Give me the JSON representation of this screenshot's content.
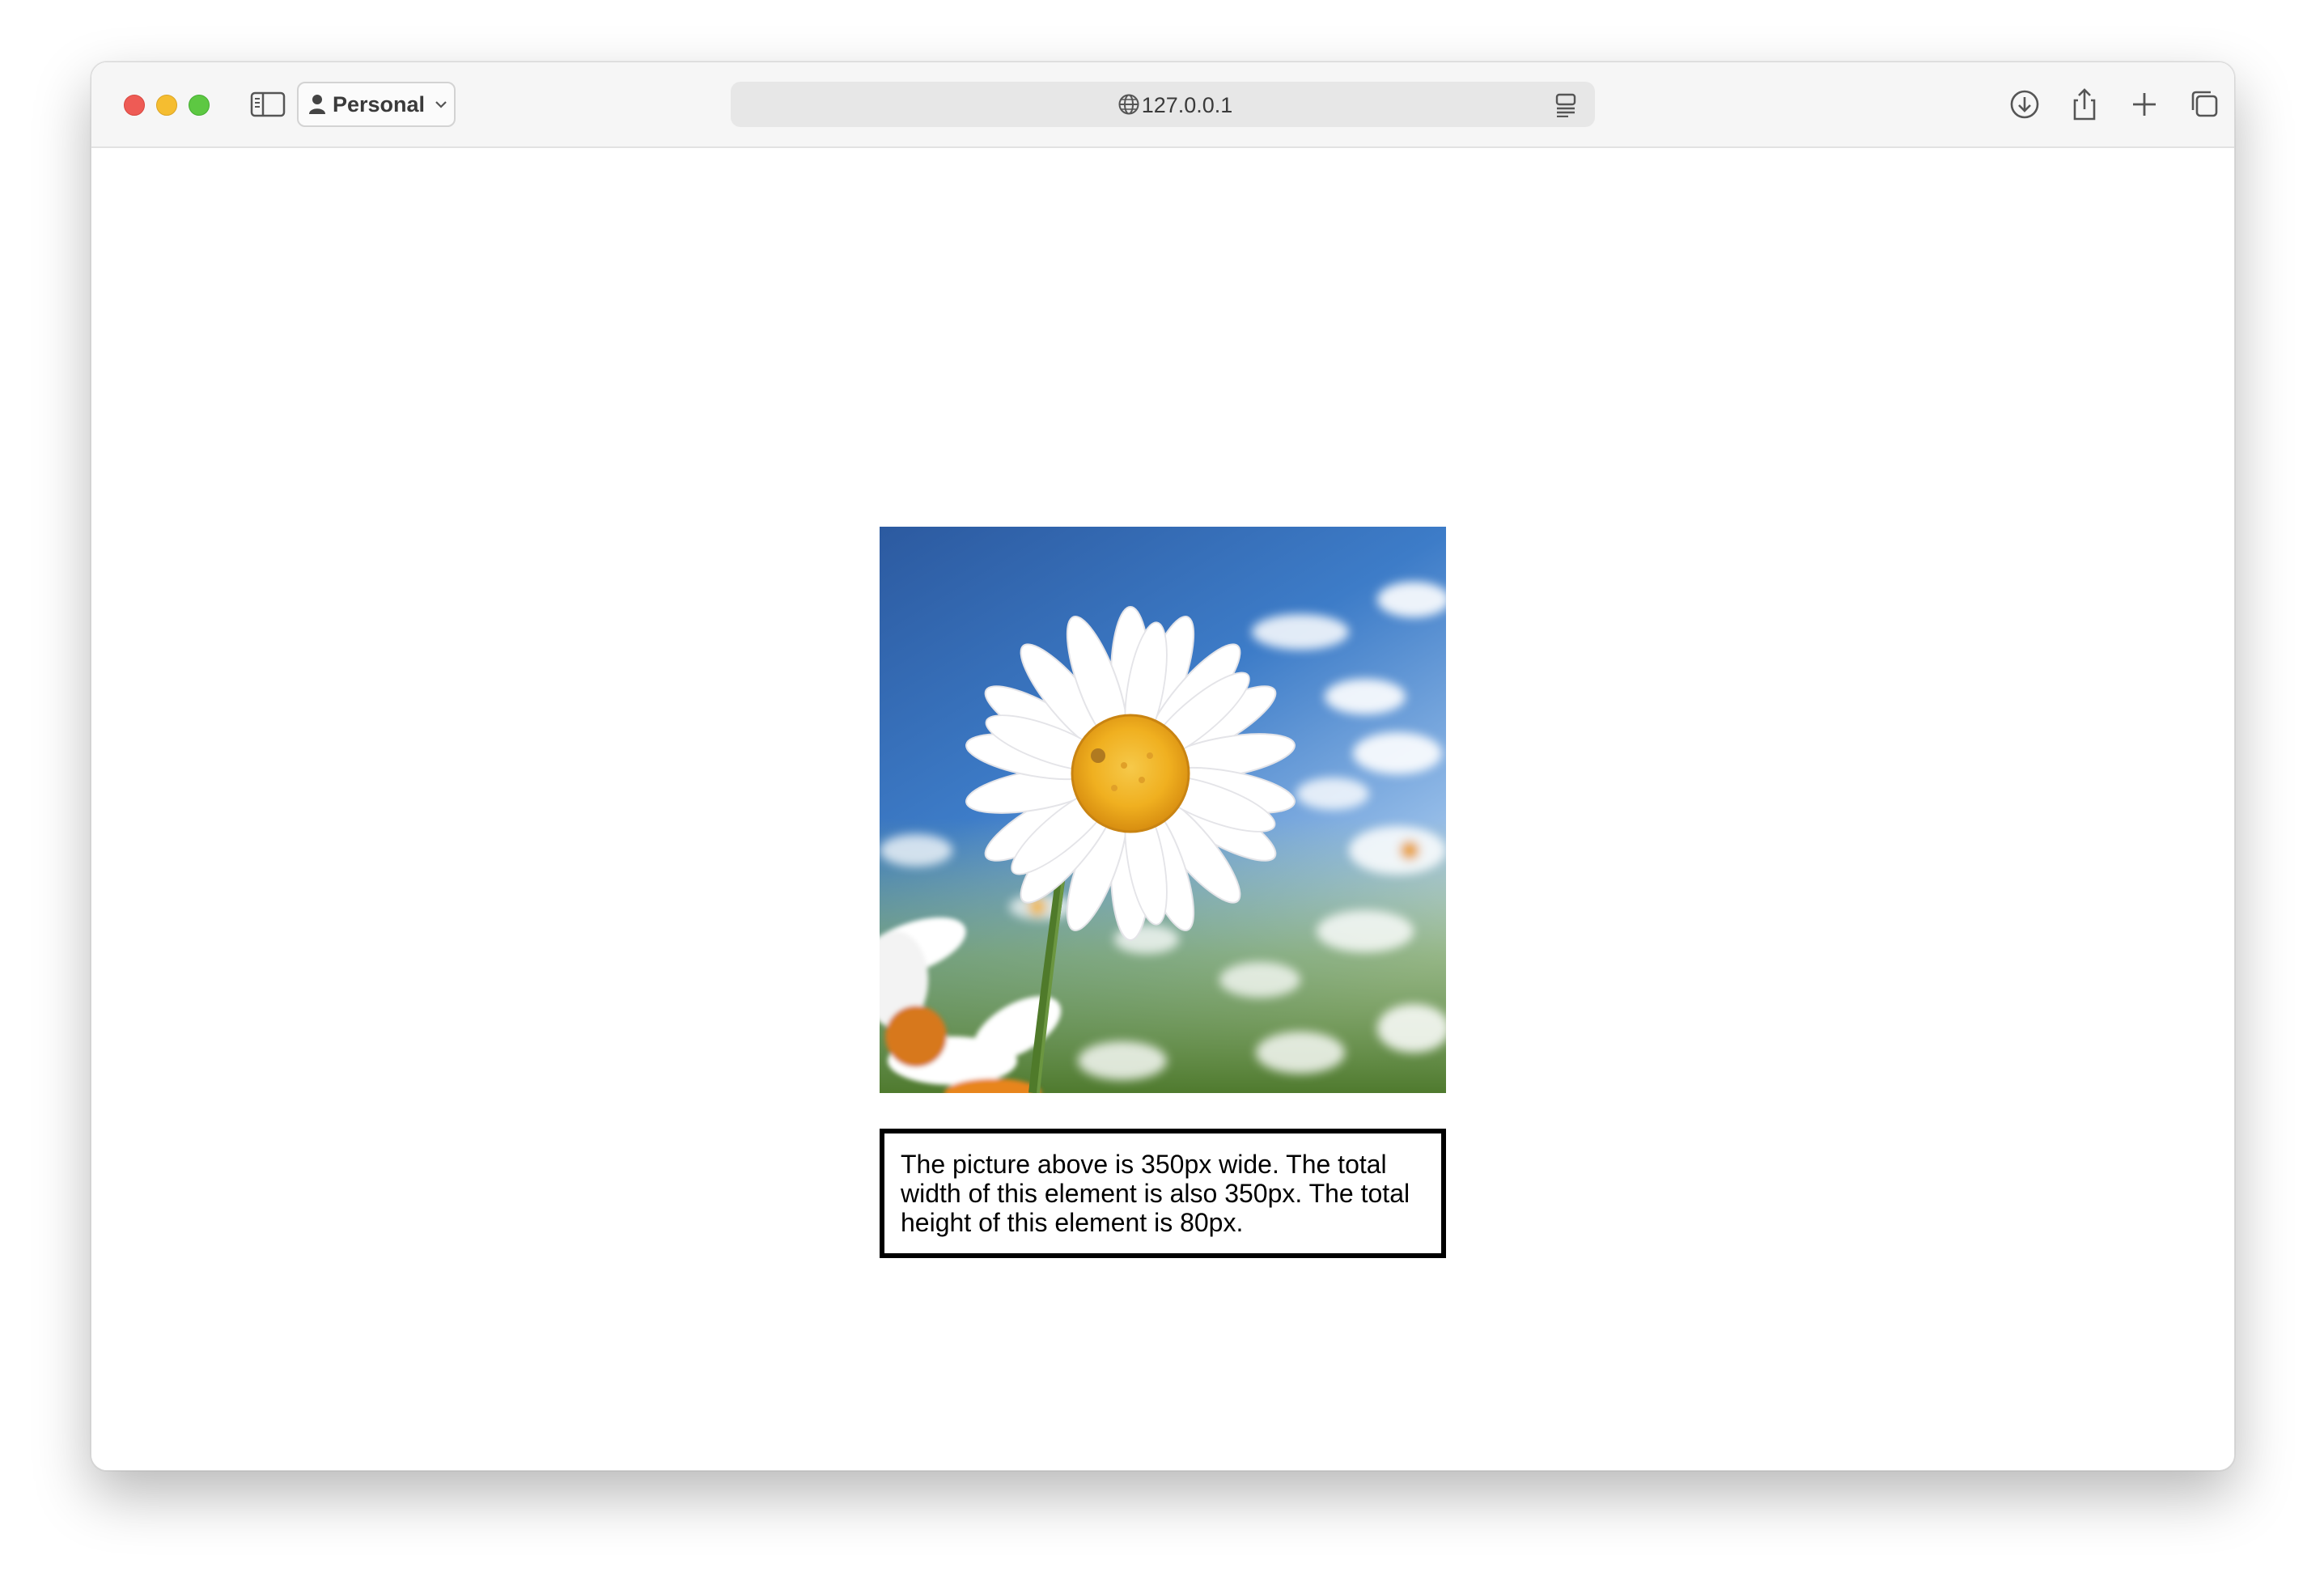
{
  "browser": {
    "profile_label": "Personal",
    "address": "127.0.0.1",
    "icons": {
      "sidebar": "sidebar-icon",
      "profile": "person-icon",
      "chevron": "chevron-down-icon",
      "globe": "globe-icon",
      "reader": "reader-icon",
      "download": "download-icon",
      "share": "share-icon",
      "new_tab": "plus-icon",
      "tabs_overview": "tabs-overview-icon"
    }
  },
  "page": {
    "image_subject": "daisy-photo",
    "caption": "The picture above is 350px wide. The total width of this element is also 350px. The total height of this element is 80px."
  }
}
